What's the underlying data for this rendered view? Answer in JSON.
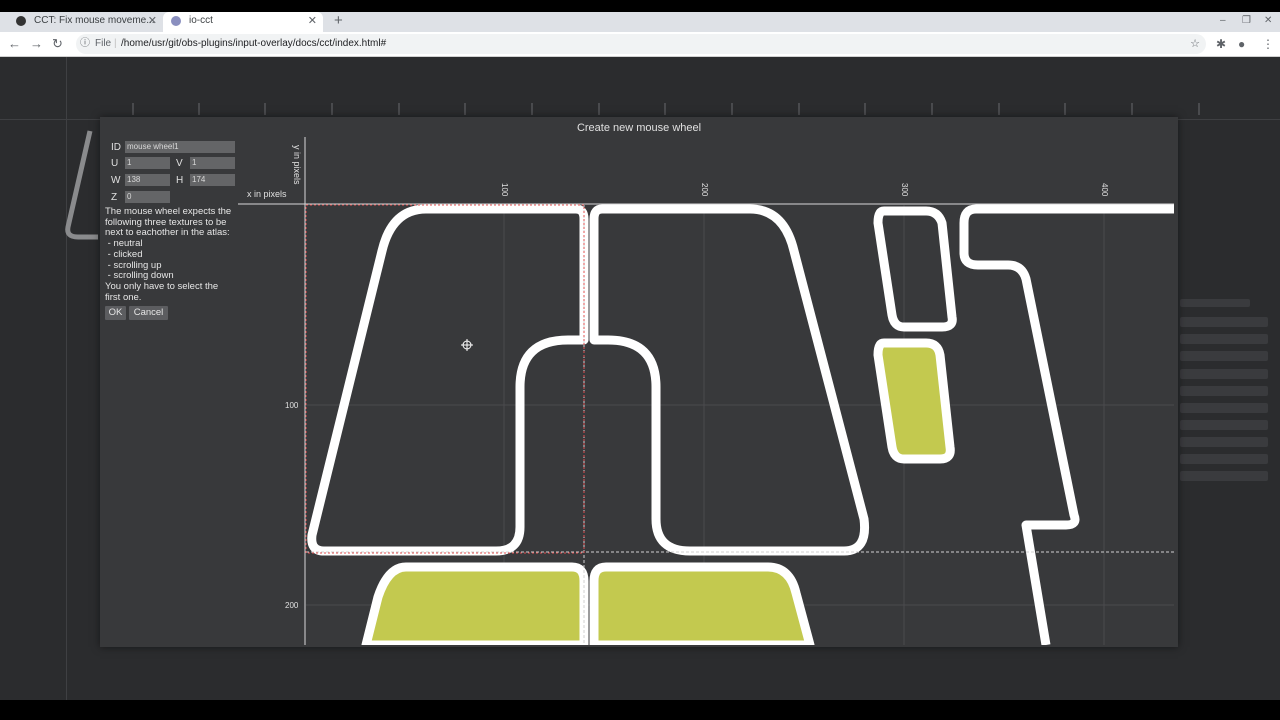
{
  "browser": {
    "tabs": [
      {
        "label": "CCT: Fix mouse moveme..."
      },
      {
        "label": "io-cct"
      }
    ],
    "url_scheme": "File",
    "url": "/home/usr/git/obs-plugins/input-overlay/docs/cct/index.html#"
  },
  "dialog": {
    "title": "Create new mouse wheel",
    "fields": {
      "id_label": "ID",
      "id_value": "mouse wheel1",
      "u_label": "U",
      "u_value": "1",
      "v_label": "V",
      "v_value": "1",
      "w_label": "W",
      "w_value": "138",
      "h_label": "H",
      "h_value": "174",
      "z_label": "Z",
      "z_value": "0"
    },
    "help_lines": [
      "The mouse wheel expects the",
      "following three textures to be",
      "next to eachother in the atlas:",
      " - neutral",
      " - clicked",
      " - scrolling up",
      " - scrolling down",
      "You only have to select the",
      "first one."
    ],
    "ok_label": "OK",
    "cancel_label": "Cancel"
  },
  "canvas": {
    "x_axis_label": "x in pixels",
    "y_axis_label": "y in pixels",
    "x_ticks": [
      "100",
      "200",
      "300",
      "400"
    ],
    "y_ticks": [
      "100",
      "200"
    ],
    "colors": {
      "background": "#38393b",
      "outline": "#ffffff",
      "fill": "#c3c94f",
      "selection": "#e05050",
      "guide": "#d0d0d0",
      "grid": "#4a4b4e"
    }
  }
}
